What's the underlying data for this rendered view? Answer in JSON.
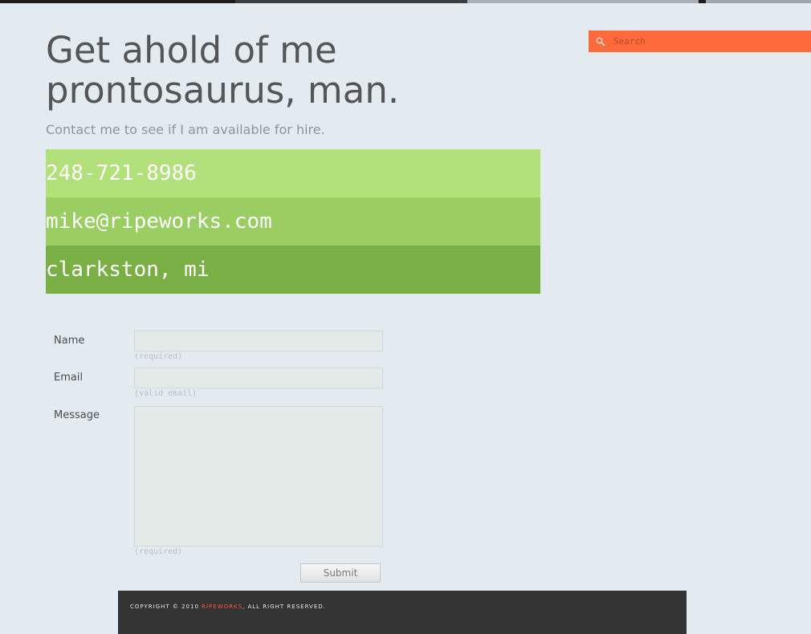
{
  "search": {
    "placeholder": "Search"
  },
  "headline": "Get ahold of me prontosaurus, man.",
  "subhead": "Contact me to see if I am available for hire.",
  "contact": {
    "phone": "248-721-8986",
    "email": "mike@ripeworks.com",
    "location": "clarkston, mi",
    "colors": [
      "#b2e07a",
      "#9acd62",
      "#7aaf45"
    ]
  },
  "form": {
    "name_label": "Name",
    "name_hint": "(required)",
    "email_label": "Email",
    "email_hint": "(valid email)",
    "message_label": "Message",
    "message_hint": "(required)",
    "submit_label": "Submit"
  },
  "footer": {
    "copyright_prefix": "Copyright © 2010 ",
    "brand": "Ripeworks",
    "copyright_suffix": ", All right reserved."
  },
  "colors": {
    "accent": "#ff6a3d",
    "footer_bg": "#333333",
    "page_bg": "#e3ebf1"
  },
  "icons": {
    "search": "search-icon"
  }
}
